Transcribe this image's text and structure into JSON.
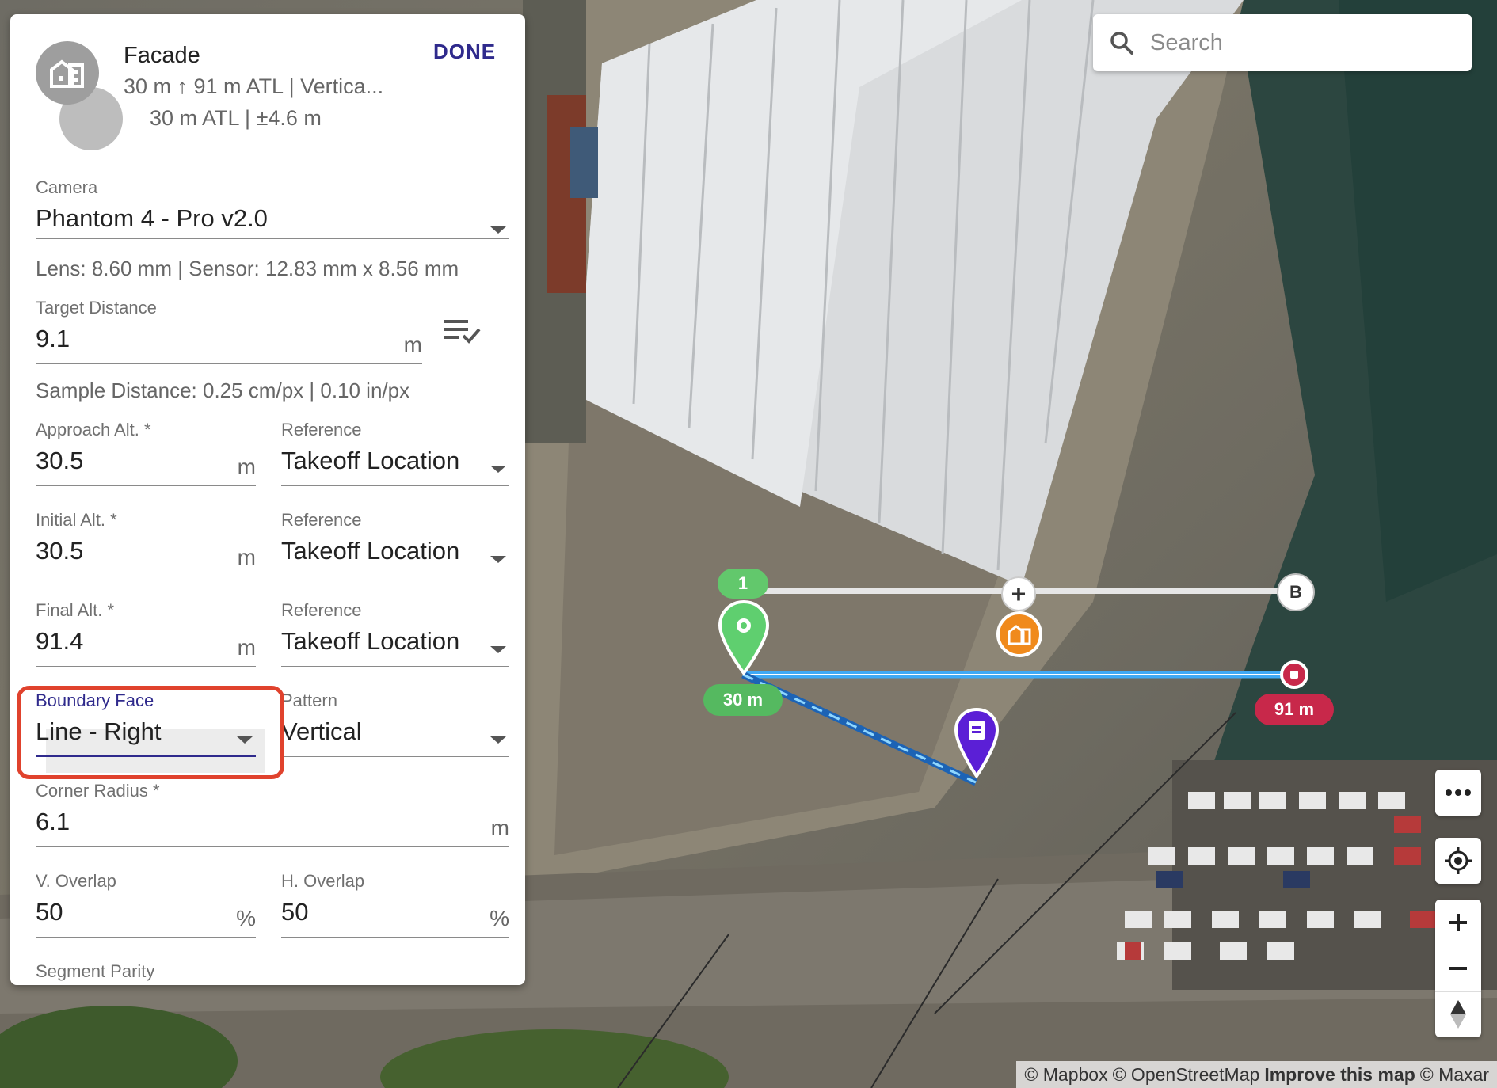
{
  "panel": {
    "title": "Facade",
    "subtitle1": "30 m ↑ 91 m ATL | Vertica...",
    "subtitle2": "30 m ATL | ±4.6 m",
    "done_label": "DONE",
    "camera": {
      "label": "Camera",
      "value": "Phantom 4 - Pro v2.0"
    },
    "lens_info": "Lens: 8.60 mm | Sensor: 12.83 mm x 8.56 mm",
    "target_distance": {
      "label": "Target Distance",
      "value": "9.1",
      "unit": "m"
    },
    "sample_distance": "Sample Distance: 0.25 cm/px | 0.10 in/px",
    "approach_alt": {
      "label": "Approach Alt. *",
      "value": "30.5",
      "unit": "m"
    },
    "approach_ref": {
      "label": "Reference",
      "value": "Takeoff Location"
    },
    "initial_alt": {
      "label": "Initial Alt. *",
      "value": "30.5",
      "unit": "m"
    },
    "initial_ref": {
      "label": "Reference",
      "value": "Takeoff Location"
    },
    "final_alt": {
      "label": "Final Alt. *",
      "value": "91.4",
      "unit": "m"
    },
    "final_ref": {
      "label": "Reference",
      "value": "Takeoff Location"
    },
    "boundary_face": {
      "label": "Boundary Face",
      "value": "Line - Right"
    },
    "pattern": {
      "label": "Pattern",
      "value": "Vertical"
    },
    "corner_radius": {
      "label": "Corner Radius *",
      "value": "6.1",
      "unit": "m"
    },
    "v_overlap": {
      "label": "V. Overlap",
      "value": "50",
      "unit": "%"
    },
    "h_overlap": {
      "label": "H. Overlap",
      "value": "50",
      "unit": "%"
    },
    "segment_parity": {
      "label": "Segment Parity"
    }
  },
  "search": {
    "placeholder": "Search"
  },
  "map": {
    "marker_1_label": "1",
    "marker_b_label": "B",
    "start_alt_label": "30 m",
    "end_alt_label": "91 m",
    "add_point_symbol": "+"
  },
  "attribution": {
    "mapbox": "© Mapbox",
    "osm": "© OpenStreetMap",
    "improve": "Improve this map",
    "maxar": "© Maxar"
  },
  "colors": {
    "accent": "#2f2a8c",
    "highlight": "#e0422d",
    "marker_green": "#5fcf6f",
    "marker_red": "#c8284a",
    "marker_orange": "#f08a1c",
    "marker_purple": "#5b1fd6",
    "path_blue": "#3fa9f5"
  }
}
